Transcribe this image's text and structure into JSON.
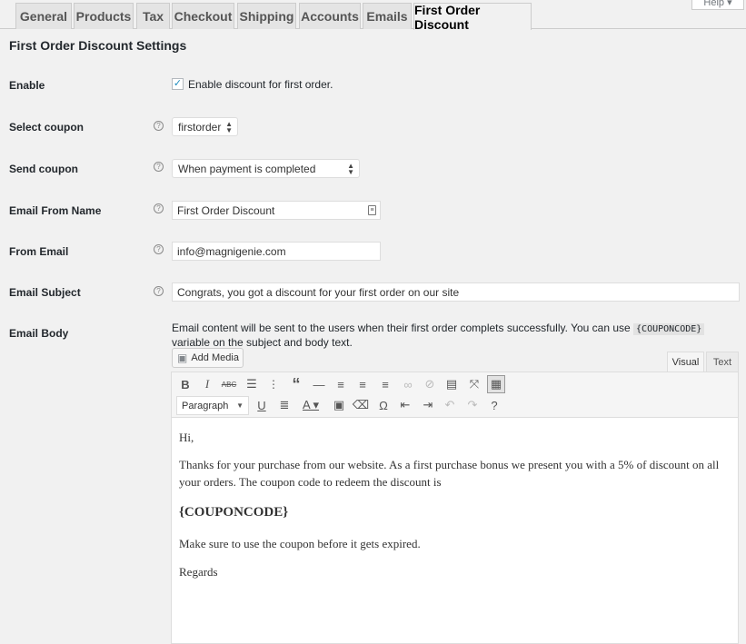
{
  "help_tab": {
    "label": "Help ▾"
  },
  "tabs": [
    {
      "label": "General"
    },
    {
      "label": "Products"
    },
    {
      "label": "Tax"
    },
    {
      "label": "Checkout"
    },
    {
      "label": "Shipping"
    },
    {
      "label": "Accounts"
    },
    {
      "label": "Emails"
    },
    {
      "label": "First Order Discount"
    }
  ],
  "active_tab": "First Order Discount",
  "settings": {
    "title": "First Order Discount Settings",
    "enable": {
      "label": "Enable",
      "checked": true,
      "checkbox_label": "Enable discount for first order."
    },
    "select_coupon": {
      "label": "Select coupon",
      "value": "firstorder"
    },
    "send_coupon": {
      "label": "Send coupon",
      "value": "When payment is completed"
    },
    "email_from_name": {
      "label": "Email From Name",
      "value": "First Order Discount"
    },
    "from_email": {
      "label": "From Email",
      "value": "info@magnigenie.com"
    },
    "email_subject": {
      "label": "Email Subject",
      "value": "Congrats, you got a discount for your first order on our site"
    },
    "email_body": {
      "label": "Email Body",
      "desc_before": "Email content will be sent to the users when their first order complets successfully. You can use ",
      "desc_code": "{COUPONCODE}",
      "desc_after": " variable on the subject and body text."
    }
  },
  "editor": {
    "add_media_label": "Add Media",
    "tab_visual": "Visual",
    "tab_text": "Text",
    "format_value": "Paragraph",
    "content": {
      "greeting": "Hi,",
      "body1": "Thanks for your purchase from our website. As a first purchase bonus we present you with a 5% of discount on all your orders. The coupon code to redeem the discount is",
      "code": "{COUPONCODE}",
      "body2": "Make sure to use the coupon before it gets expired.",
      "closing": "Regards"
    }
  },
  "colors": {
    "accent": "#1e8cbe",
    "background": "#f1f1f1"
  }
}
